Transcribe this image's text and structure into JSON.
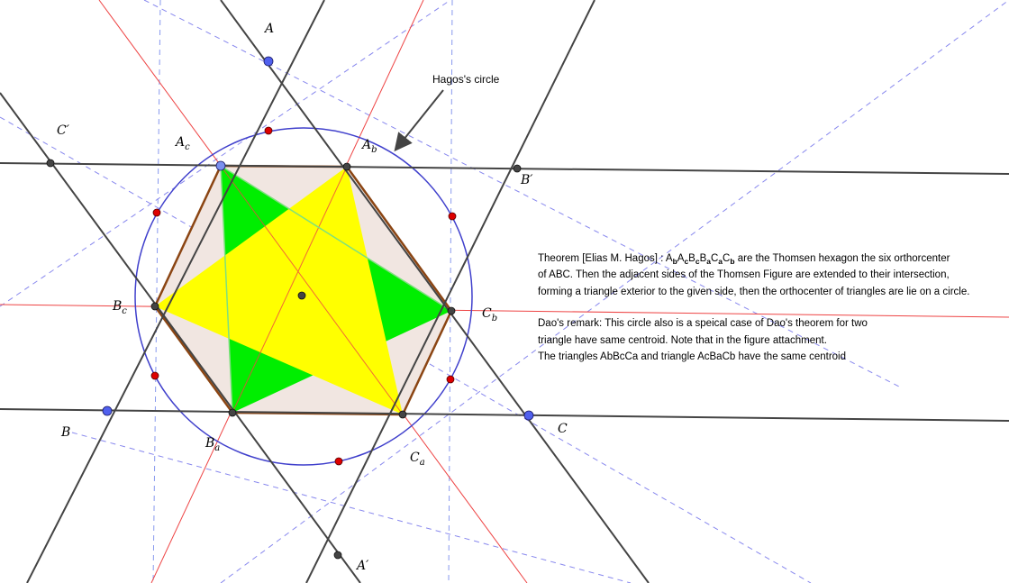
{
  "diagram": {
    "labels": {
      "A": "A",
      "B": "B",
      "C": "C",
      "A_prime": "A′",
      "B_prime": "B′",
      "C_prime": "C′",
      "Ac_base": "A",
      "Ac_sub": "c",
      "Ab_base": "A",
      "Ab_sub": "b",
      "Bc_base": "B",
      "Bc_sub": "c",
      "Ba_base": "B",
      "Ba_sub": "a",
      "Cb_base": "C",
      "Cb_sub": "b",
      "Ca_base": "C",
      "Ca_sub": "a"
    },
    "circle_label": "Hagos's circle",
    "theorem": {
      "line1_prefix": "Theorem [Elias M. Hagos] : A",
      "line1_s1": "b",
      "line1_t1": "A",
      "line1_s2": "c",
      "line1_t2": "B",
      "line1_s3": "c",
      "line1_t3": "B",
      "line1_s4": "a",
      "line1_t4": "C",
      "line1_s5": "a",
      "line1_t5": "C",
      "line1_s6": "b",
      "line1_suffix": " are the Thomsen hexagon the six orthorcenter",
      "line2": "of ABC. Then  the adjacent sides of the Thomsen Figure are extended to their intersection,",
      "line3": "forming a triangle exterior to  the given side, then the orthocenter of triangles are lie on a circle."
    },
    "remark": {
      "line1": "Dao's remark: This circle also is a speical case of Dao's theorem for two",
      "line2": " triangle have same centroid. Note that in the figure attachment.",
      "line3": "The triangles AbBcCa and triangle AcBaCb have the same centroid"
    },
    "colors": {
      "hexagon_fill": "#f1e6e1",
      "hexagon_stroke": "#8b4513",
      "triangle_yellow": "#ffff00",
      "triangle_green": "#00ee00",
      "circle": "#4040cc",
      "red_line": "#ee4444",
      "dashed_line": "#8888ee",
      "black_line": "#444444",
      "vertex_blue": "#5060ee",
      "point_red": "#dd0000"
    }
  }
}
